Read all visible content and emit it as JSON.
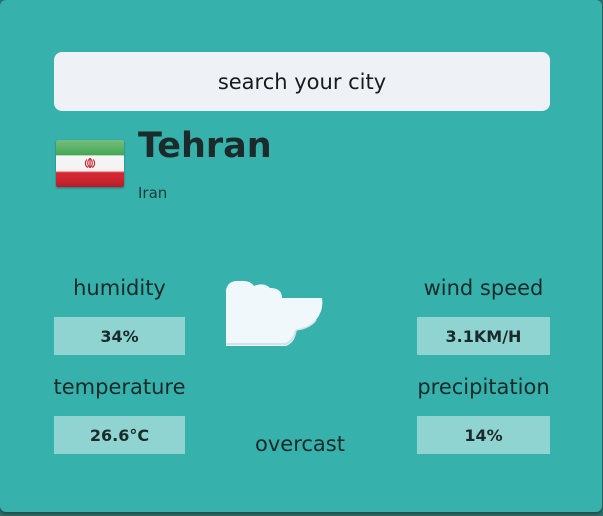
{
  "search": {
    "placeholder": "search your city"
  },
  "location": {
    "city": "Tehran",
    "country": "Iran"
  },
  "stats": {
    "humidity": {
      "label": "humidity",
      "value": "34%"
    },
    "temperature": {
      "label": "temperature",
      "value": "26.6°C"
    },
    "wind_speed": {
      "label": "wind speed",
      "value": "3.1KM/H"
    },
    "precipitation": {
      "label": "precipitation",
      "value": "14%"
    }
  },
  "weather": {
    "condition": "overcast",
    "icon": "cloud-icon"
  },
  "colors": {
    "card": "#37b1ab",
    "value_box": "#8fd4d1",
    "search_bg": "#eef2f6"
  }
}
